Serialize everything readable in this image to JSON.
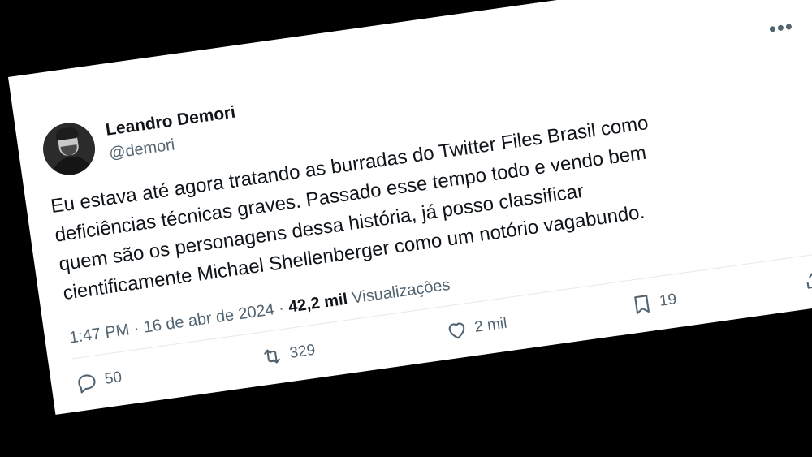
{
  "tweet": {
    "author_name": "Leandro Demori",
    "author_handle": "@demori",
    "more_icon": "more-horizontal-icon",
    "lines": [
      "Eu estava até agora tratando as burradas do Twitter Files Brasil como",
      "deficiências técnicas graves. Passado esse tempo todo e vendo bem",
      "quem são os personagens dessa história, já posso classificar",
      "cientificamente Michael Shellenberger como um notório vagabundo."
    ],
    "time": "1:47 PM",
    "separator": "·",
    "date": "16 de abr de 2024",
    "views_count": "42,2 mil",
    "views_label": "Visualizações"
  },
  "actions": {
    "reply_count": "50",
    "retweet_count": "329",
    "like_count": "2 mil",
    "bookmark_count": "19",
    "share_icon": "share-icon"
  },
  "colors": {
    "text": "#0f1419",
    "secondary": "#536471",
    "background": "#ffffff",
    "surround": "#000000"
  }
}
